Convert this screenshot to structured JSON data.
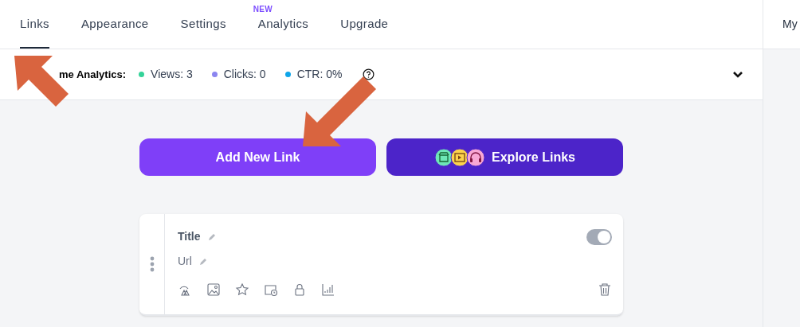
{
  "tabs": [
    {
      "label": "Links",
      "selected": true
    },
    {
      "label": "Appearance",
      "selected": false
    },
    {
      "label": "Settings",
      "selected": false
    },
    {
      "label": "Analytics",
      "selected": false,
      "badge": "NEW"
    },
    {
      "label": "Upgrade",
      "selected": false
    }
  ],
  "side_panel": {
    "title": "My"
  },
  "analytics_bar": {
    "label": "me Analytics:",
    "stats": [
      {
        "text": "Views: 3",
        "color": "#34d399"
      },
      {
        "text": "Clicks: 0",
        "color": "#8b85f0"
      },
      {
        "text": "CTR: 0%",
        "color": "#0ea5e9"
      }
    ],
    "expanded": false
  },
  "actions": [
    {
      "label": "Add New Link",
      "kind": "primary"
    },
    {
      "label": "Explore Links",
      "kind": "explore"
    }
  ],
  "link_card": {
    "title": "Title",
    "url": "Url",
    "on": true
  }
}
